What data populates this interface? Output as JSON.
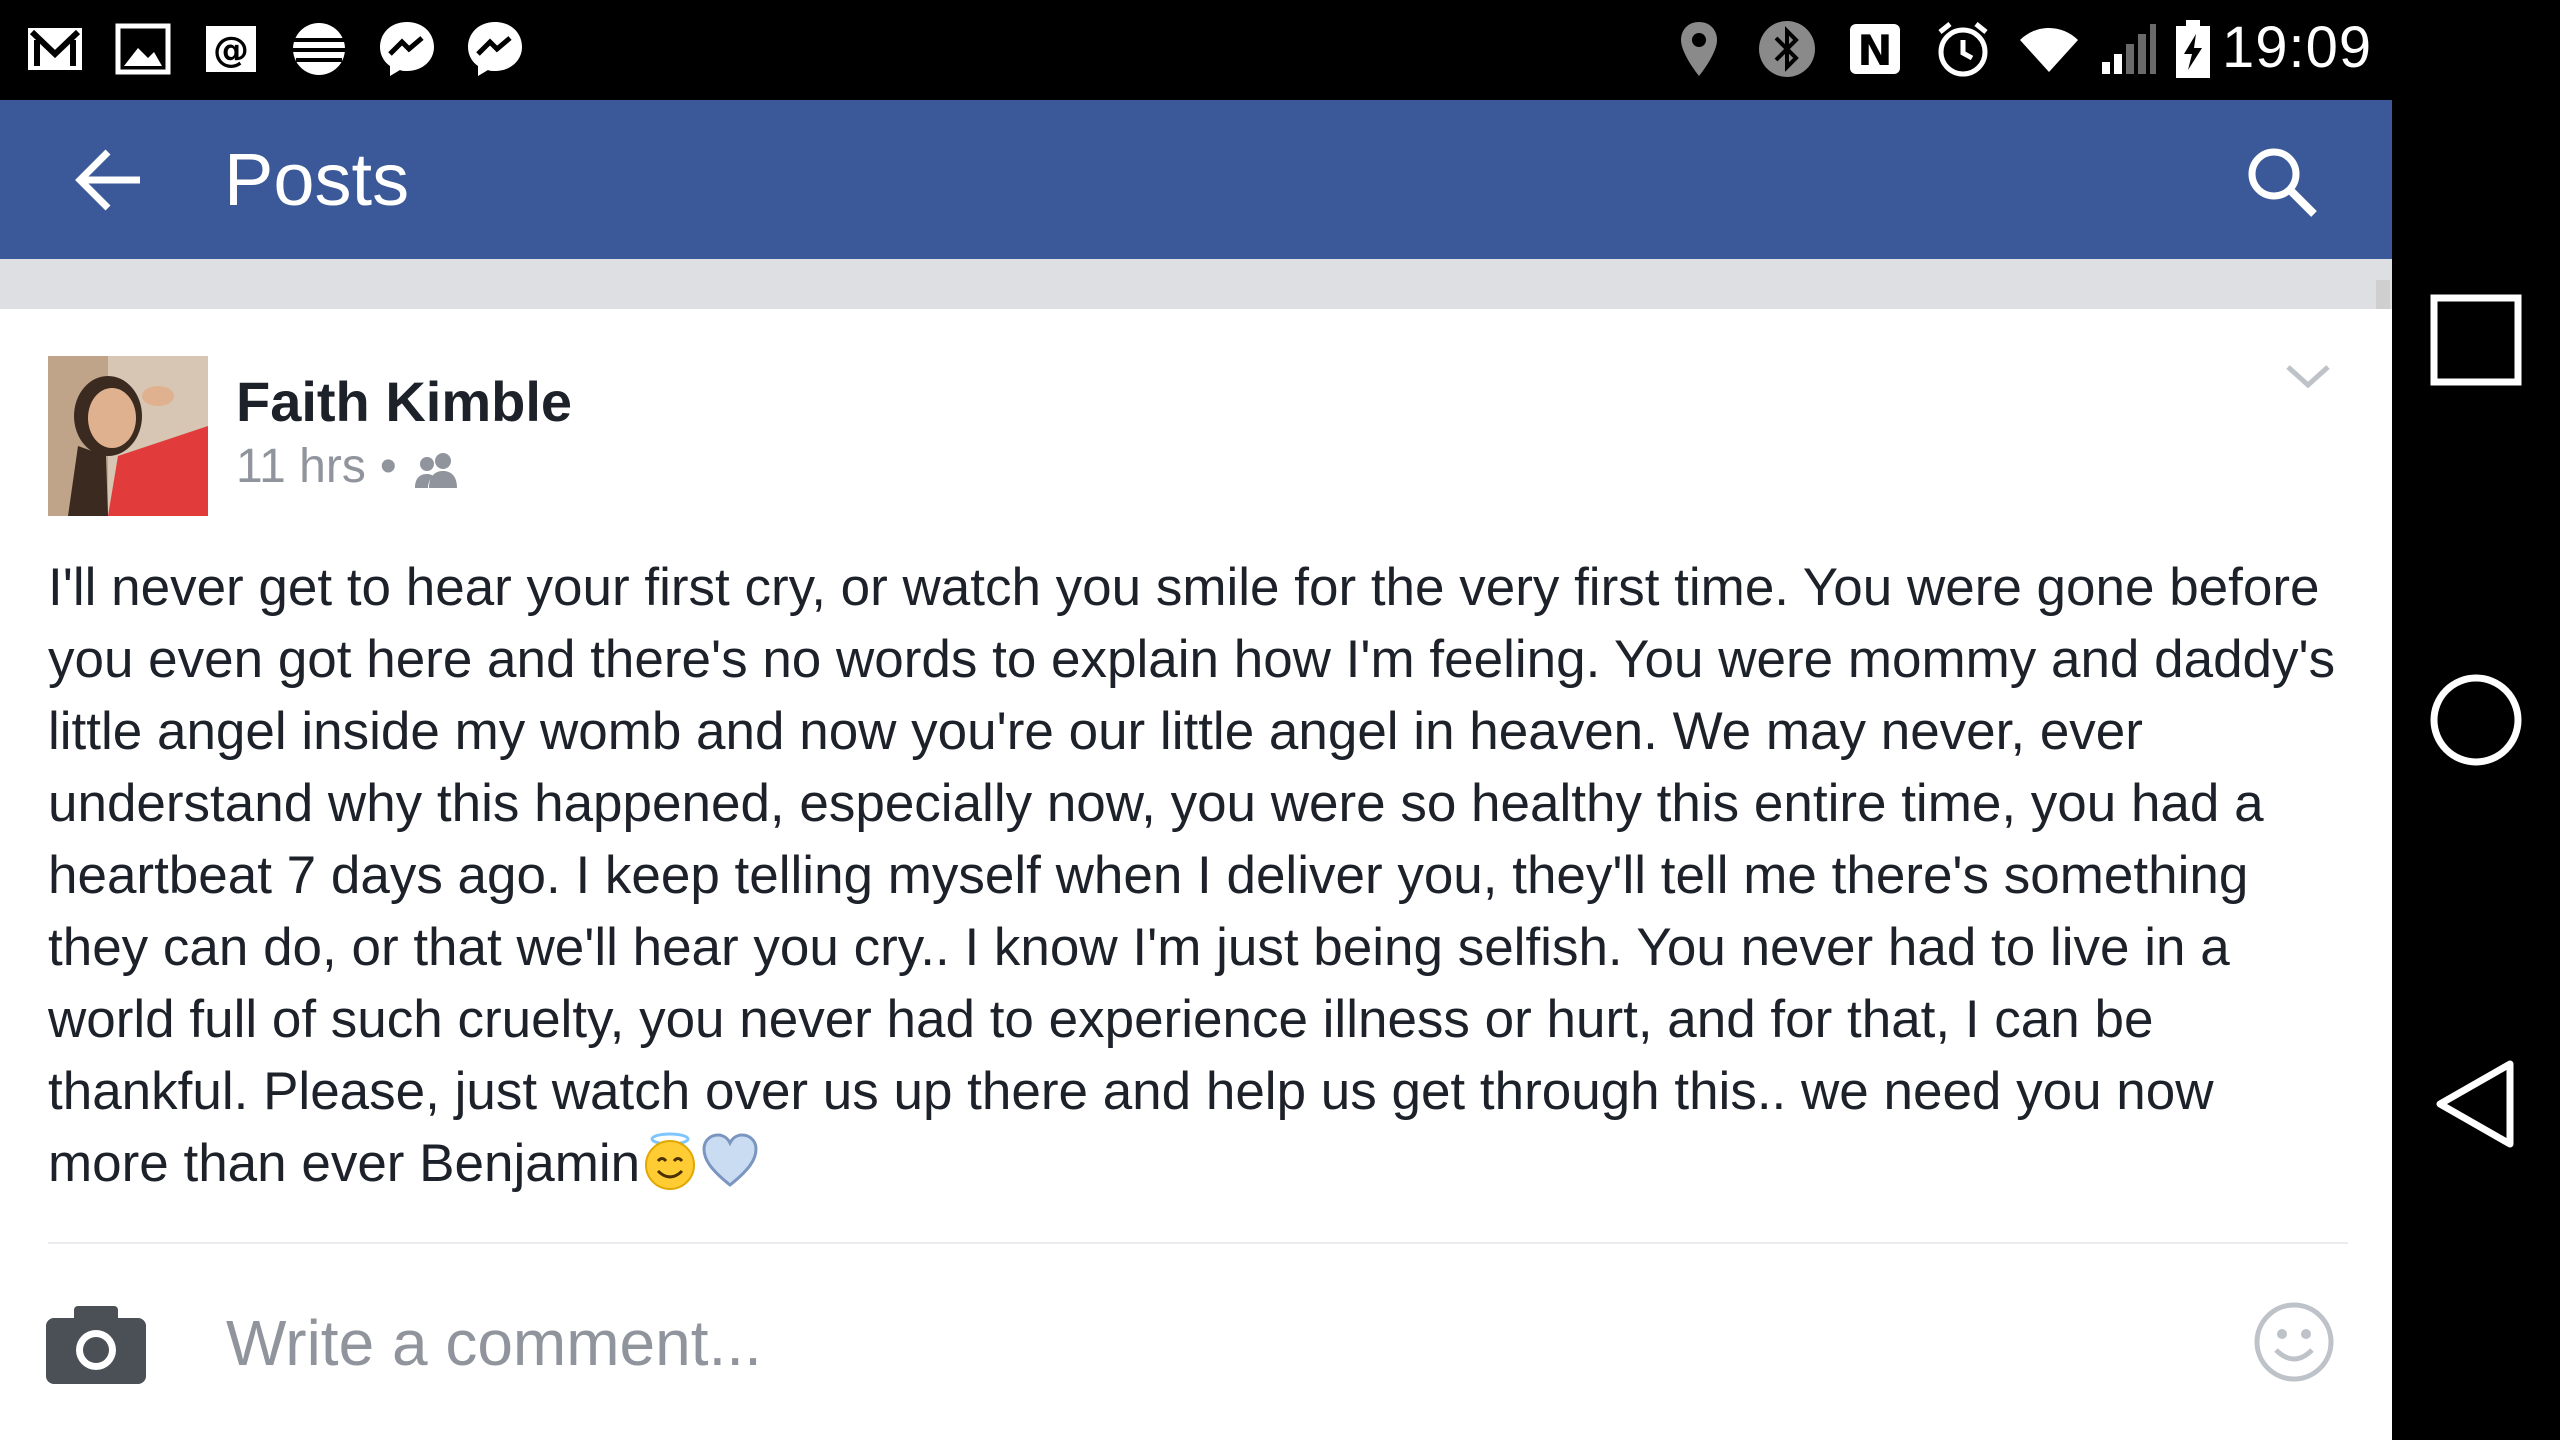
{
  "status_bar": {
    "time": "19:09",
    "left_icons": [
      "gmail-icon",
      "gallery-icon",
      "email-icon",
      "att-icon",
      "messenger-icon",
      "messenger-icon"
    ],
    "right_icons": [
      "location-icon",
      "bluetooth-icon",
      "nfc-icon",
      "alarm-icon",
      "wifi-icon",
      "signal-icon",
      "battery-charging-icon"
    ]
  },
  "app_bar": {
    "title": "Posts",
    "back_icon": "arrow-back-icon",
    "search_icon": "search-icon",
    "background": "#3b5998"
  },
  "post": {
    "author": "Faith Kimble",
    "time": "11 hrs",
    "separator": "•",
    "audience_icon": "friends-icon",
    "menu_icon": "chevron-down-icon",
    "text": "I'll never get to hear your first cry, or watch you smile for the very first time. You were gone before you even got here and there's no words to explain how I'm feeling. You were mommy and daddy's little angel inside my womb and now you're our little angel in heaven. We may never, ever understand why this happened, especially now, you were so healthy this entire time, you had a heartbeat 7 days ago. I keep telling myself when I deliver you, they'll tell me there's something they can do, or that we'll hear you cry.. I know I'm just being selfish. You never had to live in a world full of such cruelty, you never had to experience illness or hurt, and for that, I can be thankful. Please, just watch over us up there and help us get through this.. we need you now more than ever Benjamin",
    "trailing_emojis": [
      "angel-emoji",
      "blue-heart-emoji"
    ]
  },
  "comment_bar": {
    "placeholder": "Write a comment...",
    "value": "",
    "camera_icon": "camera-icon",
    "emoji_icon": "smiley-icon"
  },
  "nav_bar": {
    "buttons": [
      "recents-icon",
      "home-icon",
      "back-icon"
    ]
  }
}
